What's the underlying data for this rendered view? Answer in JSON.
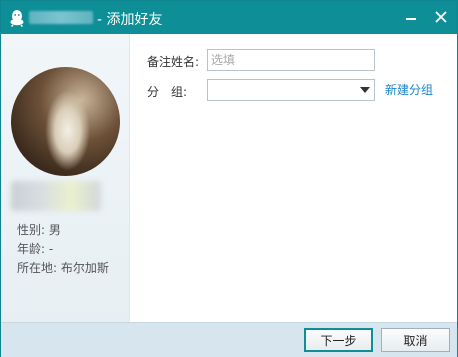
{
  "window": {
    "title": "- 添加好友",
    "accent_color": "#0e8f98",
    "icons": [
      "qq-logo-icon",
      "minimize-icon",
      "close-icon"
    ]
  },
  "profile": {
    "gender_label": "性别:",
    "gender_value": "男",
    "age_label": "年龄:",
    "age_value": "-",
    "location_label": "所在地:",
    "location_value": "布尔加斯"
  },
  "form": {
    "remark_label": "备注姓名:",
    "remark_placeholder": "选填",
    "remark_value": "",
    "group_label": "分　组:",
    "group_value": "",
    "new_group_link": "新建分组"
  },
  "buttons": {
    "next": "下一步",
    "cancel": "取消"
  }
}
